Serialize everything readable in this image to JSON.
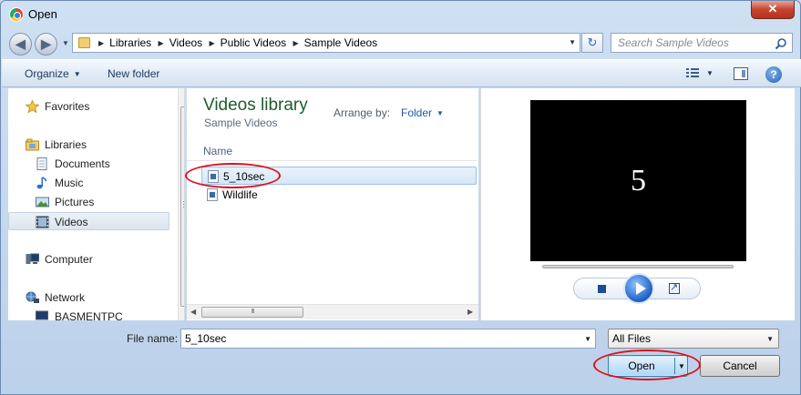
{
  "window": {
    "title": "Open",
    "close_glyph": "✕"
  },
  "nav": {
    "back_glyph": "◀",
    "forward_glyph": "▶",
    "refresh_glyph": "↻"
  },
  "address": {
    "crumbs": [
      "Libraries",
      "Videos",
      "Public Videos",
      "Sample Videos"
    ],
    "sep_glyph": "▶",
    "dropdown_glyph": "▼"
  },
  "search": {
    "placeholder": "Search Sample Videos"
  },
  "toolbar": {
    "organize_label": "Organize",
    "new_folder_label": "New folder",
    "caret_glyph": "▼",
    "help_glyph": "?"
  },
  "sidebar": {
    "items": [
      {
        "label": "Favorites",
        "icon": "star-icon"
      },
      {
        "label": "Libraries",
        "icon": "libraries-icon"
      },
      {
        "label": "Documents",
        "icon": "document-icon"
      },
      {
        "label": "Music",
        "icon": "music-icon"
      },
      {
        "label": "Pictures",
        "icon": "pictures-icon"
      },
      {
        "label": "Videos",
        "icon": "video-icon",
        "selected": true
      },
      {
        "label": "Computer",
        "icon": "computer-icon"
      },
      {
        "label": "Network",
        "icon": "network-icon"
      },
      {
        "label": "BASMENTPC",
        "icon": "pc-icon"
      }
    ]
  },
  "library": {
    "title": "Videos library",
    "subtitle": "Sample Videos",
    "arrange_label": "Arrange by:",
    "arrange_value": "Folder",
    "column_name": "Name",
    "files": [
      {
        "name": "5_10sec",
        "selected": true
      },
      {
        "name": "Wildlife",
        "selected": false
      }
    ],
    "hscroll_left": "◀",
    "hscroll_right": "▶",
    "hscroll_grip": "III"
  },
  "preview": {
    "frame_text": "5"
  },
  "bottom": {
    "file_name_label": "File name:",
    "file_name_value": "5_10sec",
    "filter_value": "All Files",
    "dropdown_glyph": "▼",
    "open_label": "Open",
    "cancel_label": "Cancel"
  },
  "annotation_color": "#e0101b"
}
